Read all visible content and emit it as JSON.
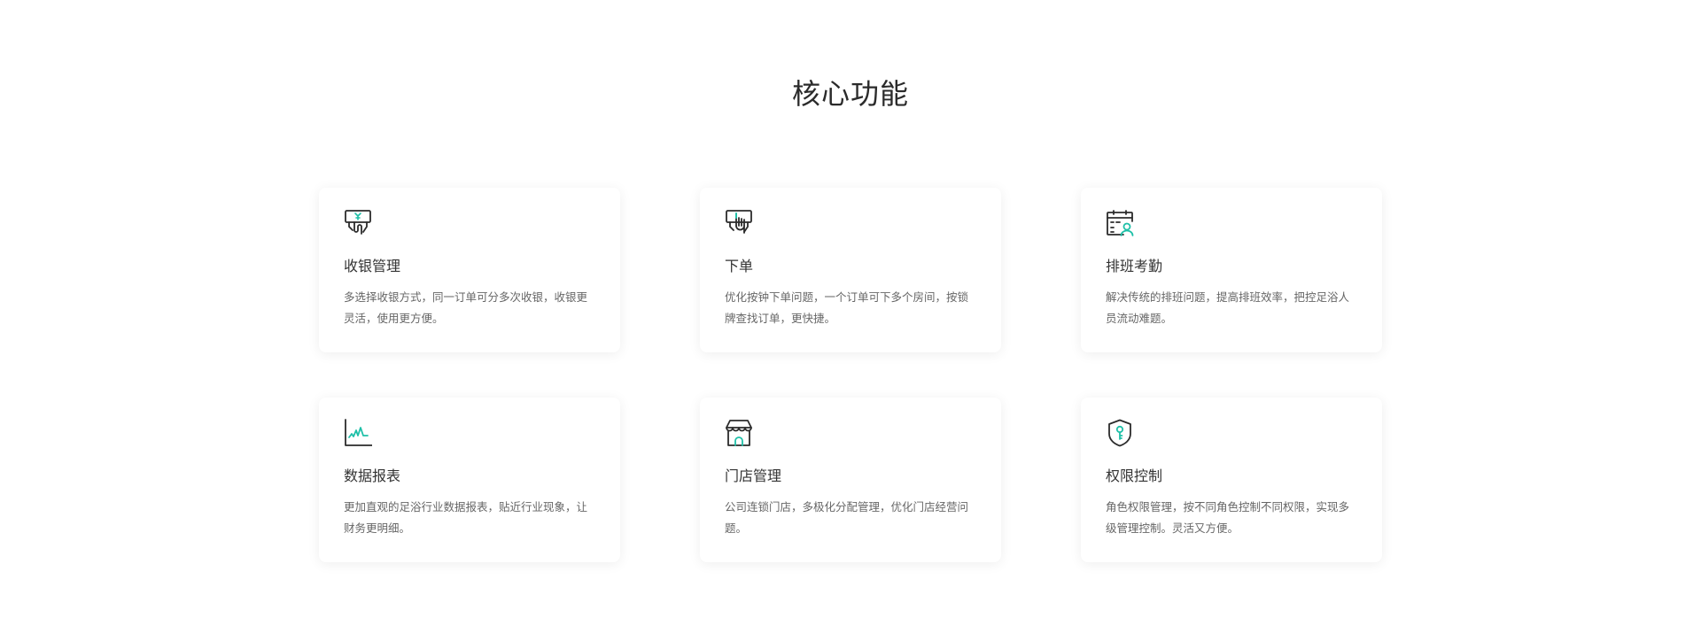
{
  "section": {
    "title": "核心功能"
  },
  "colors": {
    "accent": "#1fc0a8",
    "icon_stroke": "#2b2b2b"
  },
  "features": [
    {
      "icon": "cashier-hand-icon",
      "title": "收银管理",
      "description": "多选择收银方式，同一订单可分多次收银，收银更灵活，使用更方便。"
    },
    {
      "icon": "order-hand-icon",
      "title": "下单",
      "description": "优化按钟下单问题，一个订单可下多个房间，按锁牌查找订单，更快捷。"
    },
    {
      "icon": "schedule-attendance-icon",
      "title": "排班考勤",
      "description": "解决传统的排班问题，提高排班效率，把控足浴人员流动难题。"
    },
    {
      "icon": "report-chart-icon",
      "title": "数据报表",
      "description": "更加直观的足浴行业数据报表，贴近行业现象，让财务更明细。"
    },
    {
      "icon": "store-icon",
      "title": "门店管理",
      "description": "公司连锁门店，多极化分配管理，优化门店经营问题。"
    },
    {
      "icon": "shield-key-icon",
      "title": "权限控制",
      "description": "角色权限管理，按不同角色控制不同权限，实现多级管理控制。灵活又方便。"
    }
  ]
}
